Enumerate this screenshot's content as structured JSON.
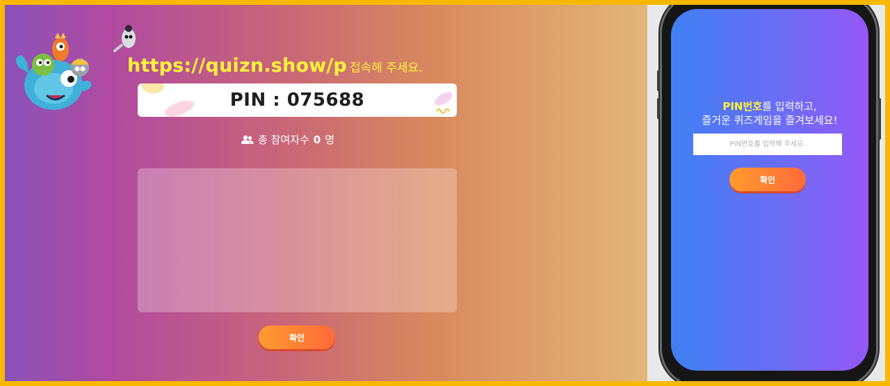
{
  "stage": {
    "url": "https://quizn.show/p",
    "url_suffix": "접속해 주세요.",
    "pin": "PIN : 075688",
    "participants": {
      "icon": "users-icon",
      "label": "총 참여자수",
      "count": "0",
      "unit": "명"
    },
    "confirm_label": "확인"
  },
  "phone": {
    "prompt_highlight": "PIN번호",
    "prompt_line1_rest": "를 입력하고,",
    "prompt_line2": "즐거운 퀴즈게임을 즐겨보세요!",
    "input_value": "",
    "input_placeholder": "PIN번호를 입력해 주세요.",
    "confirm_label": "확인"
  },
  "colors": {
    "frame": "#f8b800",
    "highlight_yellow": "#fff23a",
    "button_orange": "#ff7a34",
    "phone_screen_blue": "#3f7ff4",
    "phone_screen_purple": "#9458f6"
  }
}
